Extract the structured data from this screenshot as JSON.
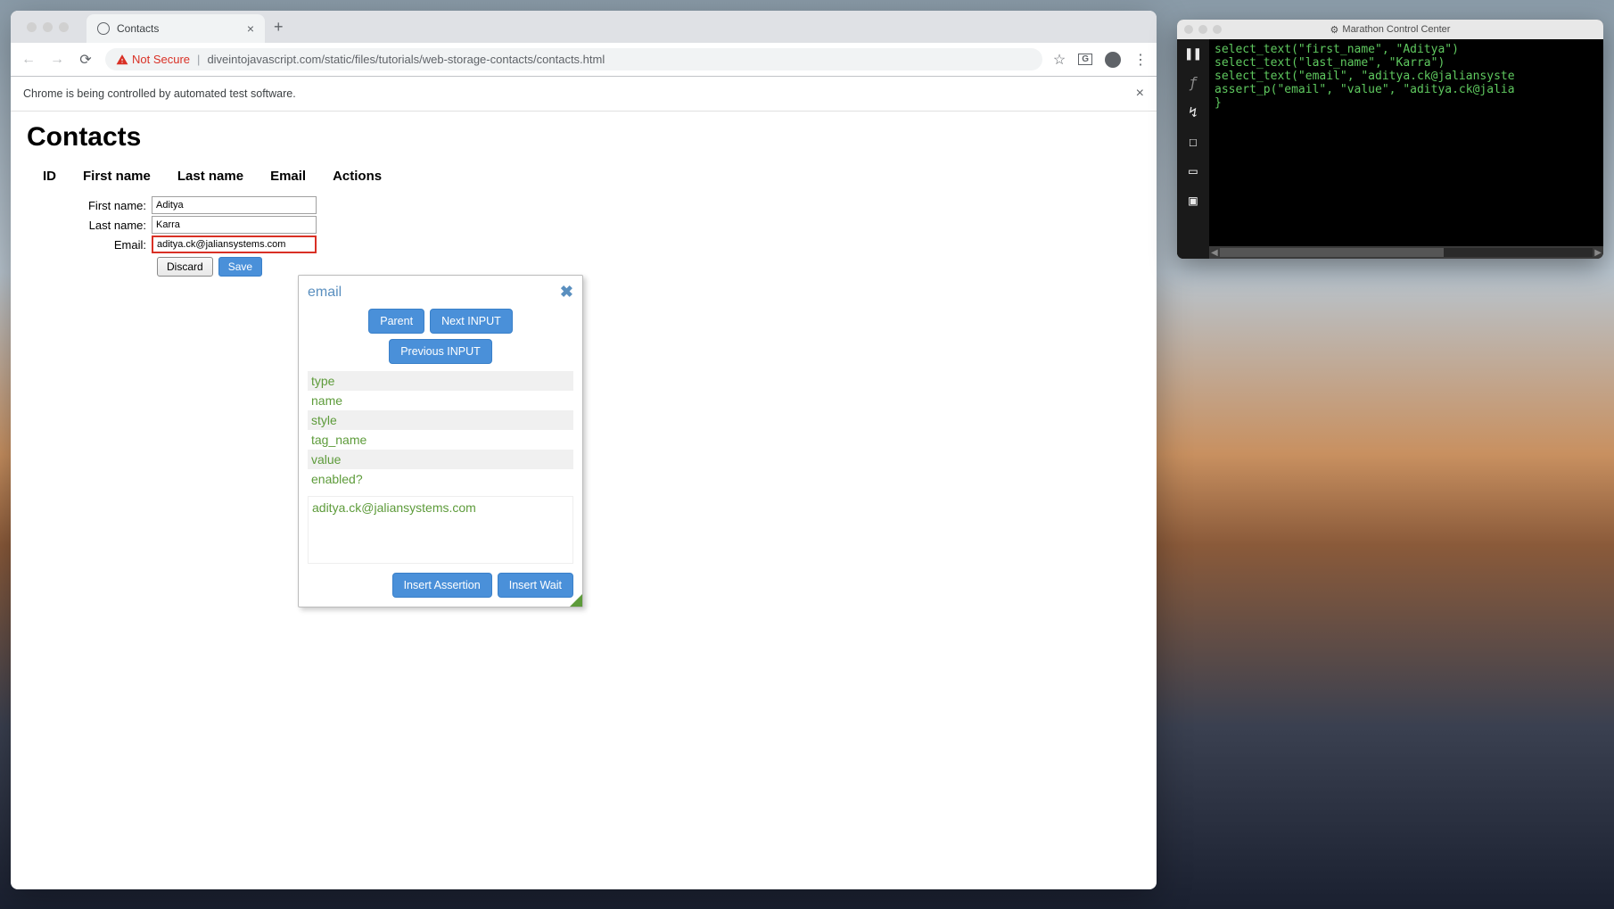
{
  "browser": {
    "tab_title": "Contacts",
    "not_secure_label": "Not Secure",
    "url_display": "diveintojavascript.com/static/files/tutorials/web-storage-contacts/contacts.html",
    "automation_banner": "Chrome is being controlled by automated test software."
  },
  "page": {
    "heading": "Contacts",
    "columns": [
      "ID",
      "First name",
      "Last name",
      "Email",
      "Actions"
    ],
    "form": {
      "first_name_label": "First name:",
      "first_name_value": "Aditya",
      "last_name_label": "Last name:",
      "last_name_value": "Karra",
      "email_label": "Email:",
      "email_value": "aditya.ck@jaliansystems.com",
      "discard_label": "Discard",
      "save_label": "Save"
    }
  },
  "inspector": {
    "title": "email",
    "parent_btn": "Parent",
    "next_btn": "Next INPUT",
    "prev_btn": "Previous INPUT",
    "properties": [
      "type",
      "name",
      "style",
      "tag_name",
      "value",
      "enabled?"
    ],
    "value_display": "aditya.ck@jaliansystems.com",
    "insert_assertion": "Insert Assertion",
    "insert_wait": "Insert Wait"
  },
  "marathon": {
    "title": "Marathon Control Center",
    "code_lines": [
      "select_text(\"first_name\", \"Aditya\")",
      "select_text(\"last_name\", \"Karra\")",
      "select_text(\"email\", \"aditya.ck@jaliansyste",
      "assert_p(\"email\", \"value\", \"aditya.ck@jalia",
      "}"
    ]
  }
}
